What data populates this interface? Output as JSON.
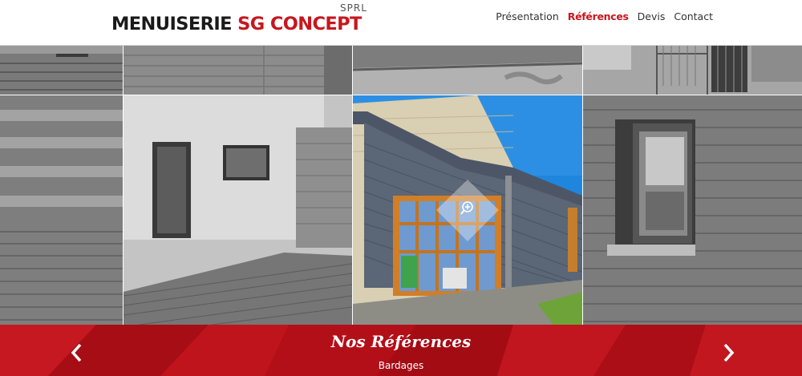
{
  "header": {
    "logo": {
      "part1": "MENUISERIE",
      "part2": "SG CONCEPT",
      "suffix": "SPRL"
    },
    "nav": [
      {
        "label": "Présentation",
        "active": false
      },
      {
        "label": "Références",
        "active": true
      },
      {
        "label": "Devis",
        "active": false
      },
      {
        "label": "Contact",
        "active": false
      }
    ]
  },
  "gallery": {
    "zoom_icon": "zoom-in-icon",
    "highlighted_tile": "bardage-window"
  },
  "banner": {
    "title": "Nos Références",
    "subtitle": "Bardages",
    "prev_icon": "chevron-left-icon",
    "next_icon": "chevron-right-icon"
  },
  "colors": {
    "brand_red": "#c8161d",
    "banner_red": "#b70f17",
    "nav_text": "#333333"
  }
}
